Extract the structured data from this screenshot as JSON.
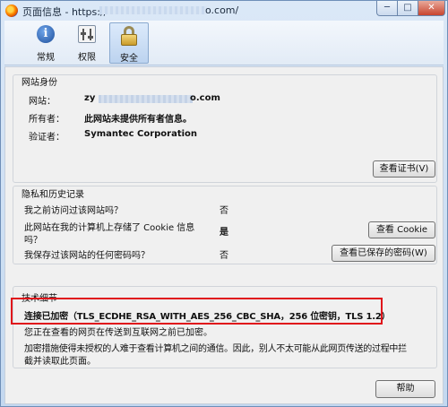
{
  "window": {
    "title_prefix": "页面信息 - https://",
    "title_suffix": "o.com/",
    "minimize_glyph": "─",
    "maximize_glyph": "□",
    "close_glyph": "✕"
  },
  "toolbar": {
    "tabs": [
      {
        "label": "常规",
        "icon": "info-icon"
      },
      {
        "label": "权限",
        "icon": "permissions-icon"
      },
      {
        "label": "安全",
        "icon": "lock-icon",
        "selected": true
      }
    ]
  },
  "identity": {
    "heading": "网站身份",
    "website_label": "网站：",
    "website_prefix": "zy",
    "website_suffix": "o.com",
    "owner_label": "所有者：",
    "owner_value": "此网站未提供所有者信息。",
    "verifier_label": "验证者：",
    "verifier_value": "Symantec Corporation",
    "view_cert_button": "查看证书(V)"
  },
  "privacy": {
    "heading": "隐私和历史记录",
    "q1": "我之前访问过该网站吗？",
    "a1": "否",
    "q2_line1": "此网站在我的计算机上存储了 Cookie 信息",
    "q2_line2": "吗？",
    "a2": "是",
    "view_cookie_button": "查看 Cookie",
    "q3": "我保存过该网站的任何密码吗？",
    "a3": "否",
    "view_passwords_button": "查看已保存的密码(W)"
  },
  "technical": {
    "heading": "技术细节",
    "connection": "连接已加密（TLS_ECDHE_RSA_WITH_AES_256_CBC_SHA，256 位密钥，TLS 1.2）",
    "encrypted_note": "您正在查看的网页在传送到互联网之前已加密。",
    "description_line1": "加密措施使得未授权的人难于查看计算机之间的通信。因此，别人不太可能从此网页传送的过程中拦",
    "description_line2": "截并读取此页面。"
  },
  "help_button": "帮助",
  "colors": {
    "highlight": "#e0151b",
    "title_bar": "#c3d8f0"
  }
}
